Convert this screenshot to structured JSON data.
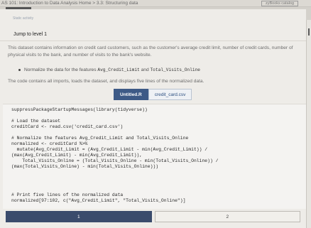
{
  "topbar": {
    "breadcrumb": "AS 101: Introduction to Data Analysis Home > 3.3: Structuring data",
    "catalog_label": "zyBooks catalog"
  },
  "content": {
    "tiny_link": "Static activity",
    "jump_label": "Jump to level 1",
    "description": "This dataset contains information on credit card customers, such as the customer's average credit limit, number of credit cards, number of physical visits to the bank, and number of visits to the bank's website.",
    "bullet_prefix": "Normalize the data for the features ",
    "bullet_feature_1": "Avg_Credit_Limit",
    "bullet_and": " and ",
    "bullet_feature_2": "Total_Visits_Online",
    "code_description": "The code contains all imports, loads the dataset, and displays five lines of the normalized data."
  },
  "file_tabs": [
    {
      "label": "Untitled.R",
      "active": true
    },
    {
      "label": "credit_card.csv",
      "active": false
    }
  ],
  "code_lines": [
    "suppressPackageStartupMessages(library(tidyverse))",
    "",
    "# Load the dataset",
    "creditCard <- read.csv('credit_card.csv')",
    "",
    "# Normalize the features Avg_Credit_Limit and Total_Visits_Online",
    "normalized <- creditCard %>%",
    "  mutate(Avg_Credit_Limit = (Avg_Credit_Limit - min(Avg_Credit_Limit)) /",
    "(max(Avg_Credit_Limit) - min(Avg_Credit_Limit)),",
    "    Total_Visits_Online = (Total_Visits_Online - min(Total_Visits_Online)) /",
    "(max(Total_Visits_Online) - min(Total_Visits_Online)))",
    "",
    "",
    "# Print five lines of the normalized data",
    "normalized[97:102, c(\"Avg_Credit_Limit\", \"Total_Visits_Online\")]"
  ],
  "pager": [
    {
      "label": "1",
      "active": true
    },
    {
      "label": "2",
      "active": false
    }
  ]
}
